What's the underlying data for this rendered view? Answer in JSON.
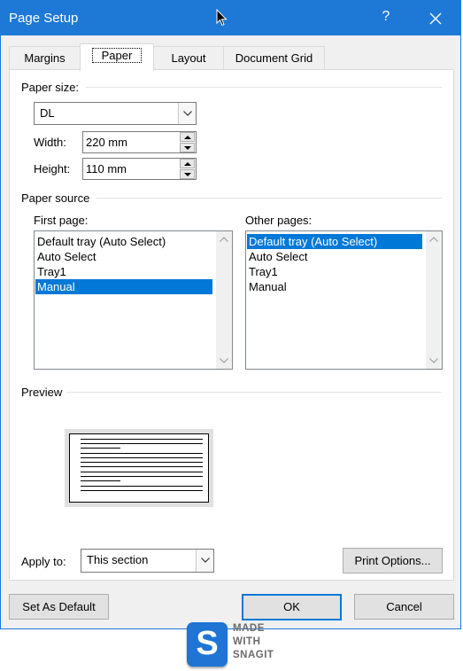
{
  "window": {
    "title": "Page Setup",
    "help": "?",
    "close": "✕"
  },
  "tabs": [
    {
      "label": "Margins",
      "active": false
    },
    {
      "label": "Paper",
      "active": true
    },
    {
      "label": "Layout",
      "active": false
    },
    {
      "label": "Document Grid",
      "active": false
    }
  ],
  "paper_size": {
    "heading": "Paper size:",
    "value": "DL",
    "width_label": "Width:",
    "width_value": "220 mm",
    "height_label": "Height:",
    "height_value": "110 mm"
  },
  "paper_source": {
    "heading": "Paper source",
    "first_page_label": "First page:",
    "first_page_items": [
      "Default tray (Auto Select)",
      "Auto Select",
      "Tray1",
      "Manual"
    ],
    "first_page_selected": "Manual",
    "other_pages_label": "Other pages:",
    "other_pages_items": [
      "Default tray (Auto Select)",
      "Auto Select",
      "Tray1",
      "Manual"
    ],
    "other_pages_selected": "Default tray (Auto Select)"
  },
  "preview": {
    "heading": "Preview"
  },
  "apply_to": {
    "label": "Apply to:",
    "value": "This section"
  },
  "buttons": {
    "print_options": "Print Options...",
    "set_as_default": "Set As Default",
    "ok": "OK",
    "cancel": "Cancel"
  },
  "watermark": {
    "line1": "MADE",
    "line2": "WITH",
    "line3": "SNAGIT",
    "logo_letter": "S"
  },
  "colors": {
    "titlebar": "#1d78d6",
    "selection": "#0078d7",
    "dialog_bg": "#f0f0f0"
  }
}
